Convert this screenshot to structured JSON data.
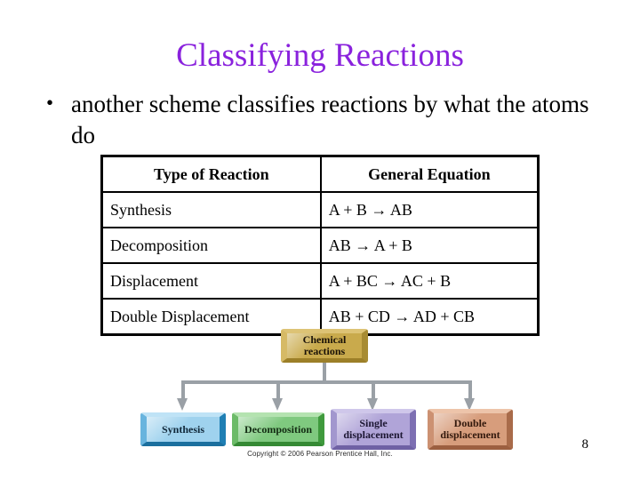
{
  "slide": {
    "title": "Classifying Reactions",
    "title_color": "#8a22dd",
    "page_number": "8"
  },
  "bullet": {
    "marker": "•",
    "line1": "another scheme classifies reactions by what",
    "line2": "the atoms do"
  },
  "table": {
    "headers": [
      "Type of Reaction",
      "General Equation"
    ],
    "rows": [
      {
        "type": "Synthesis",
        "equation": "A + B → AB"
      },
      {
        "type": "Decomposition",
        "equation": "AB → A + B"
      },
      {
        "type": "Displacement",
        "equation": "A + BC → AC + B"
      },
      {
        "type": "Double Displacement",
        "equation": "AB + CD → AD + CB"
      }
    ]
  },
  "diagram": {
    "root": {
      "line1": "Chemical",
      "line2": "reactions",
      "color": "#c9aa4c"
    },
    "children": [
      {
        "line1": "Synthesis",
        "line2": "",
        "color": "#9fd2ee"
      },
      {
        "line1": "Decomposition",
        "line2": "",
        "color": "#7fc97f"
      },
      {
        "line1": "Single",
        "line2": "displacement",
        "color": "#b0a4d8"
      },
      {
        "line1": "Double",
        "line2": "displacement",
        "color": "#d79d7c"
      }
    ],
    "copyright": "Copyright © 2006 Pearson Prentice Hall, Inc.",
    "connector_color": "#9aa0a6"
  }
}
